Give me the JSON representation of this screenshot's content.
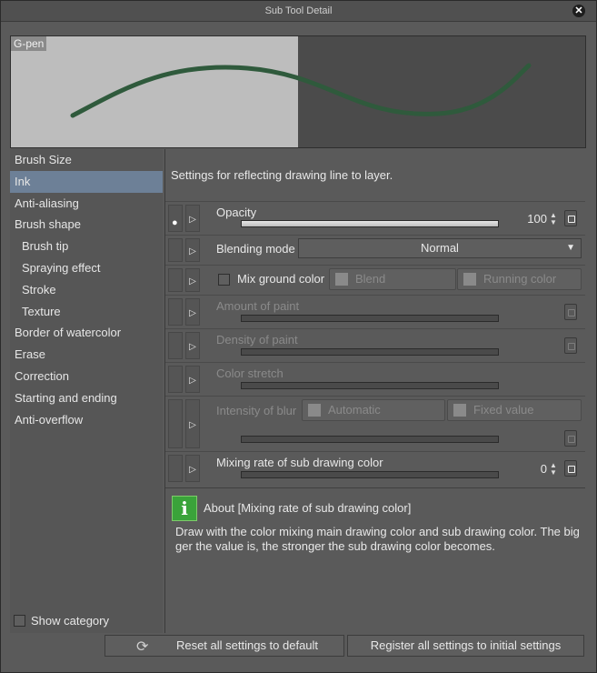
{
  "window": {
    "title": "Sub Tool Detail",
    "close_icon": "close-icon"
  },
  "preview": {
    "tool_name": "G-pen",
    "stroke_color": "#2f5a3c"
  },
  "categories": [
    {
      "label": "Brush Size",
      "sub": false
    },
    {
      "label": "Ink",
      "sub": false,
      "selected": true
    },
    {
      "label": "Anti-aliasing",
      "sub": false
    },
    {
      "label": "Brush shape",
      "sub": false
    },
    {
      "label": "Brush tip",
      "sub": true
    },
    {
      "label": "Spraying effect",
      "sub": true
    },
    {
      "label": "Stroke",
      "sub": true
    },
    {
      "label": "Texture",
      "sub": true
    },
    {
      "label": "Border of watercolor",
      "sub": false
    },
    {
      "label": "Erase",
      "sub": false
    },
    {
      "label": "Correction",
      "sub": false
    },
    {
      "label": "Starting and ending",
      "sub": false
    },
    {
      "label": "Anti-overflow",
      "sub": false
    }
  ],
  "show_category": "Show category",
  "panel": {
    "description": "Settings for reflecting drawing line to layer.",
    "opacity": {
      "label": "Opacity",
      "value": "100",
      "level": 100
    },
    "blending": {
      "label": "Blending mode",
      "value": "Normal"
    },
    "mix_ground": {
      "label": "Mix ground color",
      "blend": "Blend",
      "running": "Running color"
    },
    "amount_of_paint": {
      "label": "Amount of paint"
    },
    "density_of_paint": {
      "label": "Density of paint"
    },
    "color_stretch": {
      "label": "Color stretch"
    },
    "intensity_of_blur": {
      "label": "Intensity of blur",
      "automatic": "Automatic",
      "fixed": "Fixed value"
    },
    "mixing_rate": {
      "label": "Mixing rate of sub drawing color",
      "value": "0",
      "level": 0
    }
  },
  "help": {
    "title": "About [Mixing rate of sub drawing color]",
    "body": "Draw with the color mixing main drawing color and sub drawing color. The bigger the value is, the stronger the sub drawing color becomes."
  },
  "bottom": {
    "reset": "Reset all settings to default",
    "register": "Register all settings to initial settings"
  }
}
